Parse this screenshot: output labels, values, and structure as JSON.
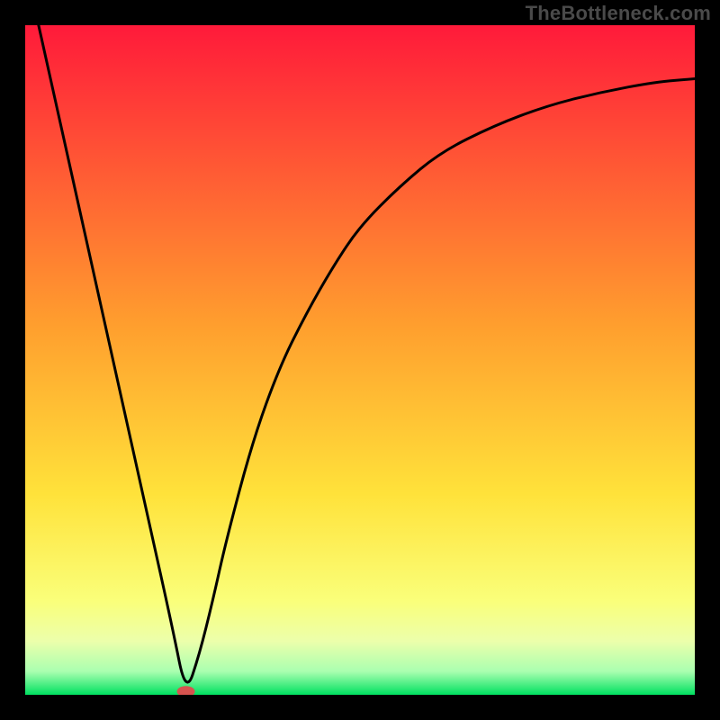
{
  "watermark": "TheBottleneck.com",
  "chart_data": {
    "type": "line",
    "title": "",
    "xlabel": "",
    "ylabel": "",
    "xlim": [
      0,
      100
    ],
    "ylim": [
      0,
      100
    ],
    "grid": false,
    "legend": false,
    "annotations": [],
    "marker": {
      "x": 24,
      "y": 0.5,
      "color": "#d6534f"
    },
    "gradient_stops": [
      {
        "offset": 0.0,
        "color": "#ff1a3a"
      },
      {
        "offset": 0.45,
        "color": "#ff9f2e"
      },
      {
        "offset": 0.7,
        "color": "#ffe23a"
      },
      {
        "offset": 0.86,
        "color": "#faff7a"
      },
      {
        "offset": 0.92,
        "color": "#ecffab"
      },
      {
        "offset": 0.965,
        "color": "#aaffb0"
      },
      {
        "offset": 1.0,
        "color": "#00e060"
      }
    ],
    "series": [
      {
        "name": "curve",
        "x": [
          2,
          6,
          10,
          14,
          18,
          22,
          24,
          26,
          28,
          30,
          34,
          38,
          42,
          46,
          50,
          56,
          62,
          70,
          78,
          86,
          94,
          100
        ],
        "y": [
          100,
          82,
          64,
          46,
          28,
          10,
          0,
          6,
          14,
          23,
          38,
          49,
          57,
          64,
          70,
          76,
          81,
          85,
          88,
          90,
          91.5,
          92
        ]
      }
    ]
  }
}
